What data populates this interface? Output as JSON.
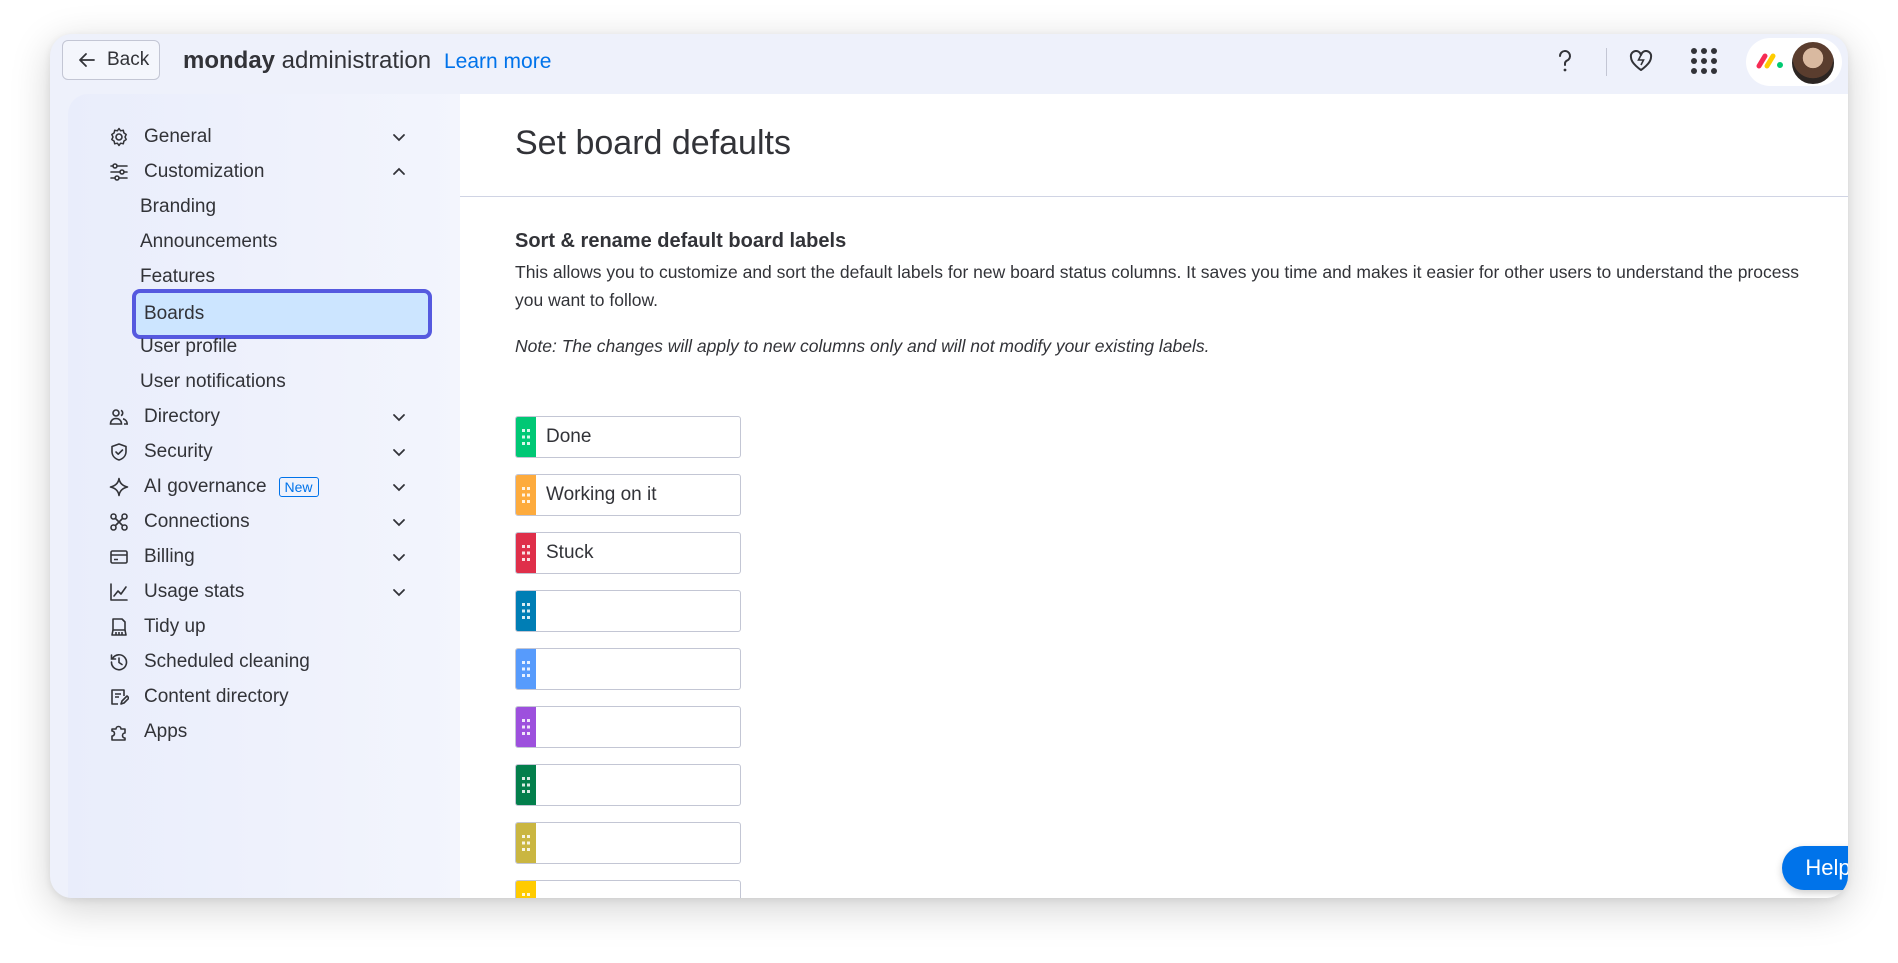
{
  "topbar": {
    "back_label": "Back",
    "brand_bold": "monday",
    "brand_rest": " administration",
    "learn_more": "Learn more",
    "help_icon": "question-mark-icon",
    "heart_icon": "heart-icon",
    "apps_icon": "grid-dots-icon",
    "logo_icon": "monday-logo-icon"
  },
  "sidebar": {
    "items": [
      {
        "label": "General",
        "icon": "gear-icon",
        "expanded": false
      },
      {
        "label": "Customization",
        "icon": "sliders-icon",
        "expanded": true
      },
      {
        "label": "Directory",
        "icon": "users-icon",
        "expanded": false
      },
      {
        "label": "Security",
        "icon": "shield-icon",
        "expanded": false
      },
      {
        "label": "AI governance",
        "icon": "sparkle-icon",
        "badge": "New",
        "expanded": false
      },
      {
        "label": "Connections",
        "icon": "connections-icon",
        "expanded": false
      },
      {
        "label": "Billing",
        "icon": "credit-card-icon",
        "expanded": false
      },
      {
        "label": "Usage stats",
        "icon": "chart-line-icon",
        "expanded": false
      },
      {
        "label": "Tidy up",
        "icon": "broom-icon"
      },
      {
        "label": "Scheduled cleaning",
        "icon": "clock-history-icon"
      },
      {
        "label": "Content directory",
        "icon": "document-edit-icon"
      },
      {
        "label": "Apps",
        "icon": "puzzle-icon"
      }
    ],
    "customization_sub": [
      {
        "label": "Branding"
      },
      {
        "label": "Announcements"
      },
      {
        "label": "Features"
      },
      {
        "label": "Boards",
        "active": true
      },
      {
        "label": "User profile"
      },
      {
        "label": "User notifications"
      }
    ]
  },
  "main": {
    "title": "Set board defaults",
    "section_title": "Sort & rename default board labels",
    "section_desc": "This allows you to customize and sort the default labels for new board status columns. It saves you time and makes it easier for other users to understand the process you want to follow.",
    "note": "Note: The changes will apply to new columns only and will not modify your existing labels.",
    "labels": [
      {
        "value": "Done",
        "color": "#00c875"
      },
      {
        "value": "Working on it",
        "color": "#fdab3d"
      },
      {
        "value": "Stuck",
        "color": "#df2f4a"
      },
      {
        "value": "",
        "color": "#007eb5"
      },
      {
        "value": "",
        "color": "#579bfc"
      },
      {
        "value": "",
        "color": "#9d50dd"
      },
      {
        "value": "",
        "color": "#037f4c"
      },
      {
        "value": "",
        "color": "#cab641"
      },
      {
        "value": "",
        "color": "#ffcb00"
      }
    ]
  },
  "help_button": "Help",
  "colors": {
    "accent": "#0073ea",
    "selection_border": "#5559df",
    "selection_bg": "#cce5ff"
  }
}
